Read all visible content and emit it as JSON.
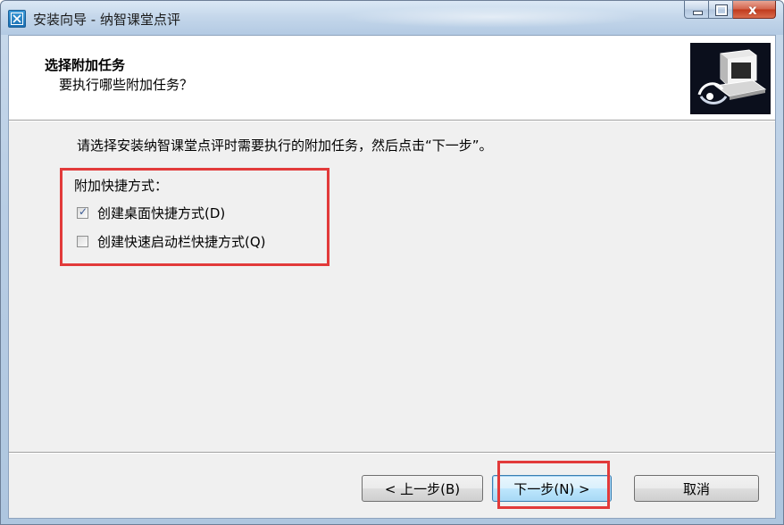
{
  "window": {
    "title": "安装向导 - 纳智课堂点评",
    "caption": {
      "minimize_icon": "minimize-icon",
      "maximize_icon": "maximize-icon",
      "close_glyph": "x"
    }
  },
  "header": {
    "title": "选择附加任务",
    "subtitle": "要执行哪些附加任务？",
    "image_icon": "computer-install-icon"
  },
  "body": {
    "instruction": "请选择安装纳智课堂点评时需要执行的附加任务，然后点击“下一步”。",
    "group_label": "附加快捷方式：",
    "options": [
      {
        "label": "创建桌面快捷方式(D)",
        "checked": true
      },
      {
        "label": "创建快速启动栏快捷方式(Q)",
        "checked": false
      }
    ]
  },
  "buttons": {
    "back": "< 上一步(B)",
    "next": "下一步(N) >",
    "cancel": "取消"
  },
  "colors": {
    "highlight": "#e23a3a",
    "client_bg": "#f0f0f0",
    "header_bg": "#ffffff"
  }
}
